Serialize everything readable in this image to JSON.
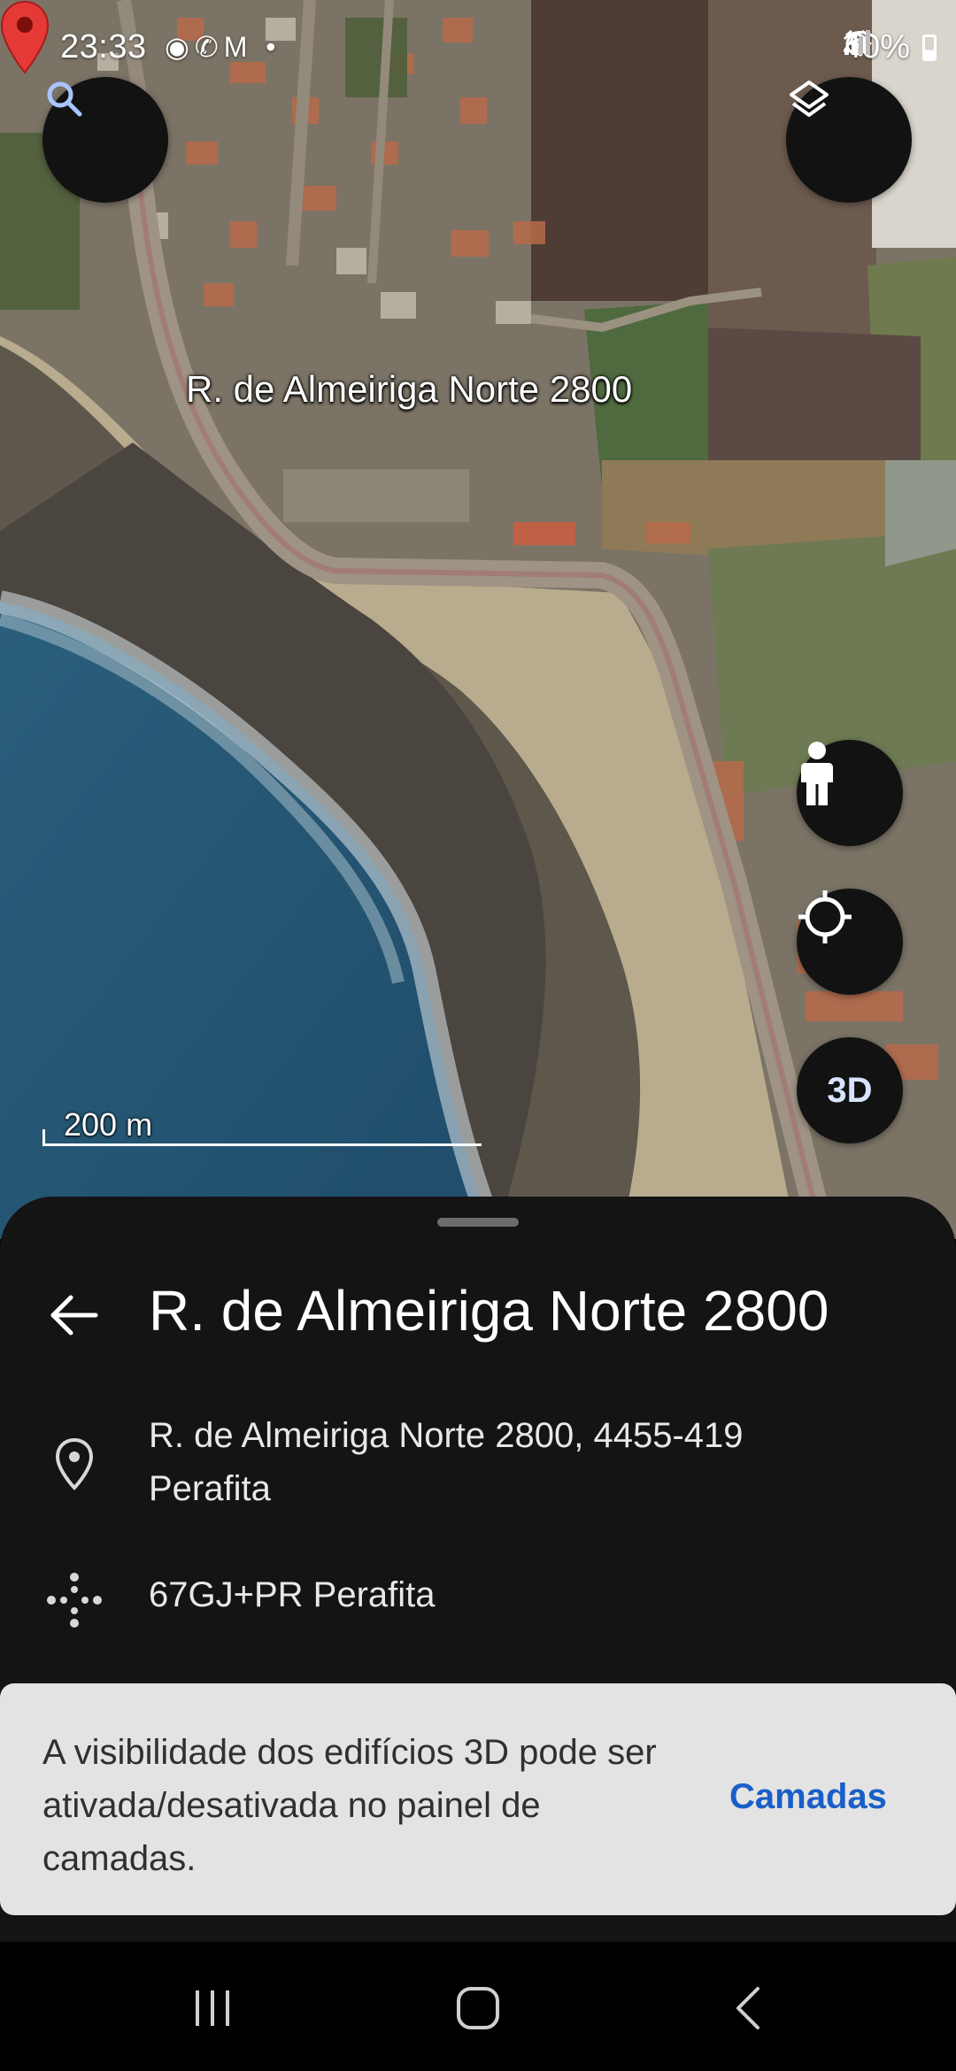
{
  "status_bar": {
    "time": "23:33",
    "app_icons": "◉✆M •",
    "battery": "40%",
    "icons": [
      "chrome-icon",
      "whatsapp-icon",
      "gmail-icon",
      "alarm-icon",
      "wifi-icon",
      "signal-icon",
      "battery-icon"
    ]
  },
  "map": {
    "place_label": "R. de Almeiriga Norte 2800",
    "scale_label": "200 m",
    "buttons": {
      "search_icon": "search-icon",
      "layers_icon": "layers-icon",
      "pegman_icon": "pegman-icon",
      "locate_icon": "my-location-icon",
      "three_d_label": "3D"
    }
  },
  "place": {
    "title": "R. de Almeiriga Norte 2800",
    "address_line1": "R. de Almeiriga Norte 2800, 4455-419",
    "address_line2": "Perafita",
    "plus_code": "67GJ+PR Perafita"
  },
  "snackbar": {
    "message": "A visibilidade dos edifícios 3D pode ser ativada/desativada no painel de camadas.",
    "action": "Camadas"
  },
  "colors": {
    "sheet_bg": "#141414",
    "snackbar_bg": "#e3e3e3",
    "accent": "#1a5fc8",
    "pin": "#e53935"
  }
}
